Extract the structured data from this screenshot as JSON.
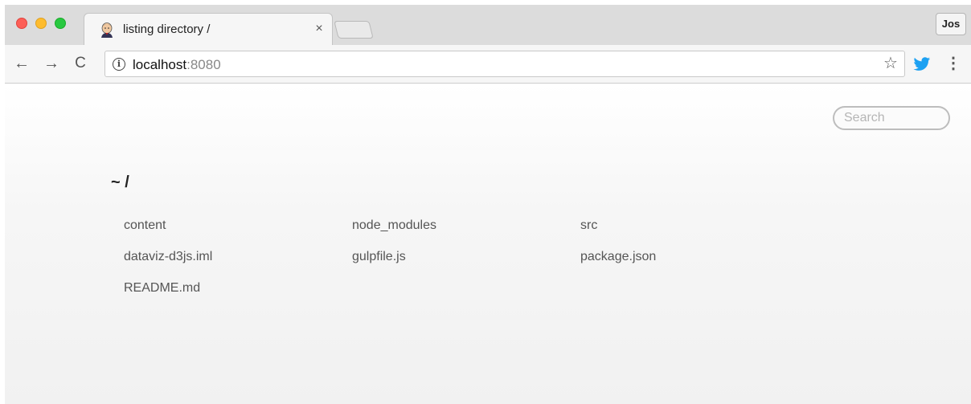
{
  "browser": {
    "tab": {
      "favicon": "jenkins-butler-icon",
      "title": "listing directory /",
      "close": "×"
    },
    "profile": "Jos",
    "nav": {
      "back": "←",
      "forward": "→",
      "reload": "C"
    },
    "address": {
      "info": "i",
      "host": "localhost",
      "port": ":8080"
    },
    "bookmark_icon": "☆",
    "menu_icon": "⋮",
    "colors": {
      "close_button": "#fd5f57",
      "minimize_button": "#febc2e",
      "maximize_button": "#28c840",
      "twitter_extension": "#1da1f2"
    }
  },
  "page": {
    "search": {
      "placeholder": "Search"
    },
    "heading": "~ /",
    "files": [
      "content",
      "node_modules",
      "src",
      "dataviz-d3js.iml",
      "gulpfile.js",
      "package.json",
      "README.md"
    ]
  }
}
